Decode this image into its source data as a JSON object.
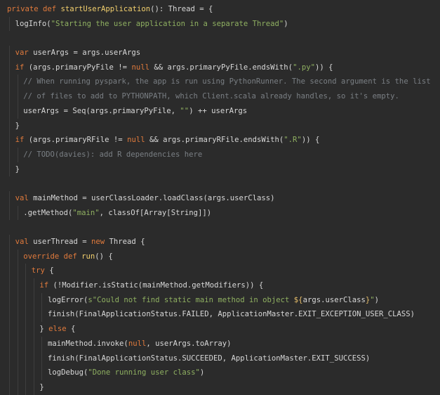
{
  "editor": {
    "language": "scala",
    "background": "#2b2b2b",
    "lines": [
      {
        "indent": 0,
        "tokens": [
          {
            "t": "private def ",
            "k": "kw"
          },
          {
            "t": "startUserApplication",
            "k": "fn"
          },
          {
            "t": "(): Thread = {",
            "k": "p"
          }
        ]
      },
      {
        "indent": 1,
        "tokens": [
          {
            "t": "logInfo(",
            "k": "p"
          },
          {
            "t": "\"Starting the user application in a separate Thread\"",
            "k": "str"
          },
          {
            "t": ")",
            "k": "p"
          }
        ]
      },
      {
        "indent": 0,
        "tokens": []
      },
      {
        "indent": 1,
        "tokens": [
          {
            "t": "var ",
            "k": "kw"
          },
          {
            "t": "userArgs = args.userArgs",
            "k": "p"
          }
        ]
      },
      {
        "indent": 1,
        "tokens": [
          {
            "t": "if ",
            "k": "kw"
          },
          {
            "t": "(args.primaryPyFile != ",
            "k": "p"
          },
          {
            "t": "null",
            "k": "kw"
          },
          {
            "t": " && args.primaryPyFile.endsWith(",
            "k": "p"
          },
          {
            "t": "\".py\"",
            "k": "str"
          },
          {
            "t": ")) {",
            "k": "p"
          }
        ]
      },
      {
        "indent": 2,
        "tokens": [
          {
            "t": "// When running pyspark, the app is run using PythonRunner. The second argument is the list",
            "k": "cmt"
          }
        ]
      },
      {
        "indent": 2,
        "tokens": [
          {
            "t": "// of files to add to PYTHONPATH, which Client.scala already handles, so it's empty.",
            "k": "cmt"
          }
        ]
      },
      {
        "indent": 2,
        "tokens": [
          {
            "t": "userArgs = Seq(args.primaryPyFile, ",
            "k": "p"
          },
          {
            "t": "\"\"",
            "k": "str"
          },
          {
            "t": ") ++ userArgs",
            "k": "p"
          }
        ]
      },
      {
        "indent": 1,
        "tokens": [
          {
            "t": "}",
            "k": "p"
          }
        ]
      },
      {
        "indent": 1,
        "tokens": [
          {
            "t": "if ",
            "k": "kw"
          },
          {
            "t": "(args.primaryRFile != ",
            "k": "p"
          },
          {
            "t": "null",
            "k": "kw"
          },
          {
            "t": " && args.primaryRFile.endsWith(",
            "k": "p"
          },
          {
            "t": "\".R\"",
            "k": "str"
          },
          {
            "t": ")) {",
            "k": "p"
          }
        ]
      },
      {
        "indent": 2,
        "tokens": [
          {
            "t": "// TODO(davies): add R dependencies here",
            "k": "cmt"
          }
        ]
      },
      {
        "indent": 1,
        "tokens": [
          {
            "t": "}",
            "k": "p"
          }
        ]
      },
      {
        "indent": 0,
        "tokens": []
      },
      {
        "indent": 1,
        "tokens": [
          {
            "t": "val ",
            "k": "kw"
          },
          {
            "t": "mainMethod = userClassLoader.loadClass(args.userClass)",
            "k": "p"
          }
        ]
      },
      {
        "indent": 2,
        "tokens": [
          {
            "t": ".getMethod(",
            "k": "p"
          },
          {
            "t": "\"main\"",
            "k": "str"
          },
          {
            "t": ", classOf[Array[String]])",
            "k": "p"
          }
        ]
      },
      {
        "indent": 0,
        "tokens": []
      },
      {
        "indent": 1,
        "tokens": [
          {
            "t": "val ",
            "k": "kw"
          },
          {
            "t": "userThread = ",
            "k": "p"
          },
          {
            "t": "new ",
            "k": "kw"
          },
          {
            "t": "Thread {",
            "k": "p"
          }
        ]
      },
      {
        "indent": 2,
        "tokens": [
          {
            "t": "override def ",
            "k": "kw"
          },
          {
            "t": "run",
            "k": "fn"
          },
          {
            "t": "() {",
            "k": "p"
          }
        ]
      },
      {
        "indent": 3,
        "tokens": [
          {
            "t": "try ",
            "k": "kw"
          },
          {
            "t": "{",
            "k": "p"
          }
        ]
      },
      {
        "indent": 4,
        "tokens": [
          {
            "t": "if ",
            "k": "kw"
          },
          {
            "t": "(!Modifier.isStatic(mainMethod.getModifiers)) {",
            "k": "p"
          }
        ]
      },
      {
        "indent": 5,
        "tokens": [
          {
            "t": "logError(",
            "k": "p"
          },
          {
            "t": "s\"Could not find static main method in object ",
            "k": "str"
          },
          {
            "t": "${",
            "k": "interp"
          },
          {
            "t": "args.userClass",
            "k": "p"
          },
          {
            "t": "}",
            "k": "interp"
          },
          {
            "t": "\"",
            "k": "str"
          },
          {
            "t": ")",
            "k": "p"
          }
        ]
      },
      {
        "indent": 5,
        "tokens": [
          {
            "t": "finish(FinalApplicationStatus.FAILED, ApplicationMaster.EXIT_EXCEPTION_USER_CLASS)",
            "k": "p"
          }
        ]
      },
      {
        "indent": 4,
        "tokens": [
          {
            "t": "} ",
            "k": "p"
          },
          {
            "t": "else ",
            "k": "kw"
          },
          {
            "t": "{",
            "k": "p"
          }
        ]
      },
      {
        "indent": 5,
        "tokens": [
          {
            "t": "mainMethod.invoke(",
            "k": "p"
          },
          {
            "t": "null",
            "k": "kw"
          },
          {
            "t": ", userArgs.toArray)",
            "k": "p"
          }
        ]
      },
      {
        "indent": 5,
        "tokens": [
          {
            "t": "finish(FinalApplicationStatus.SUCCEEDED, ApplicationMaster.EXIT_SUCCESS)",
            "k": "p"
          }
        ]
      },
      {
        "indent": 5,
        "tokens": [
          {
            "t": "logDebug(",
            "k": "p"
          },
          {
            "t": "\"Done running user class\"",
            "k": "str"
          },
          {
            "t": ")",
            "k": "p"
          }
        ]
      },
      {
        "indent": 4,
        "tokens": [
          {
            "t": "}",
            "k": "p"
          }
        ]
      }
    ]
  }
}
